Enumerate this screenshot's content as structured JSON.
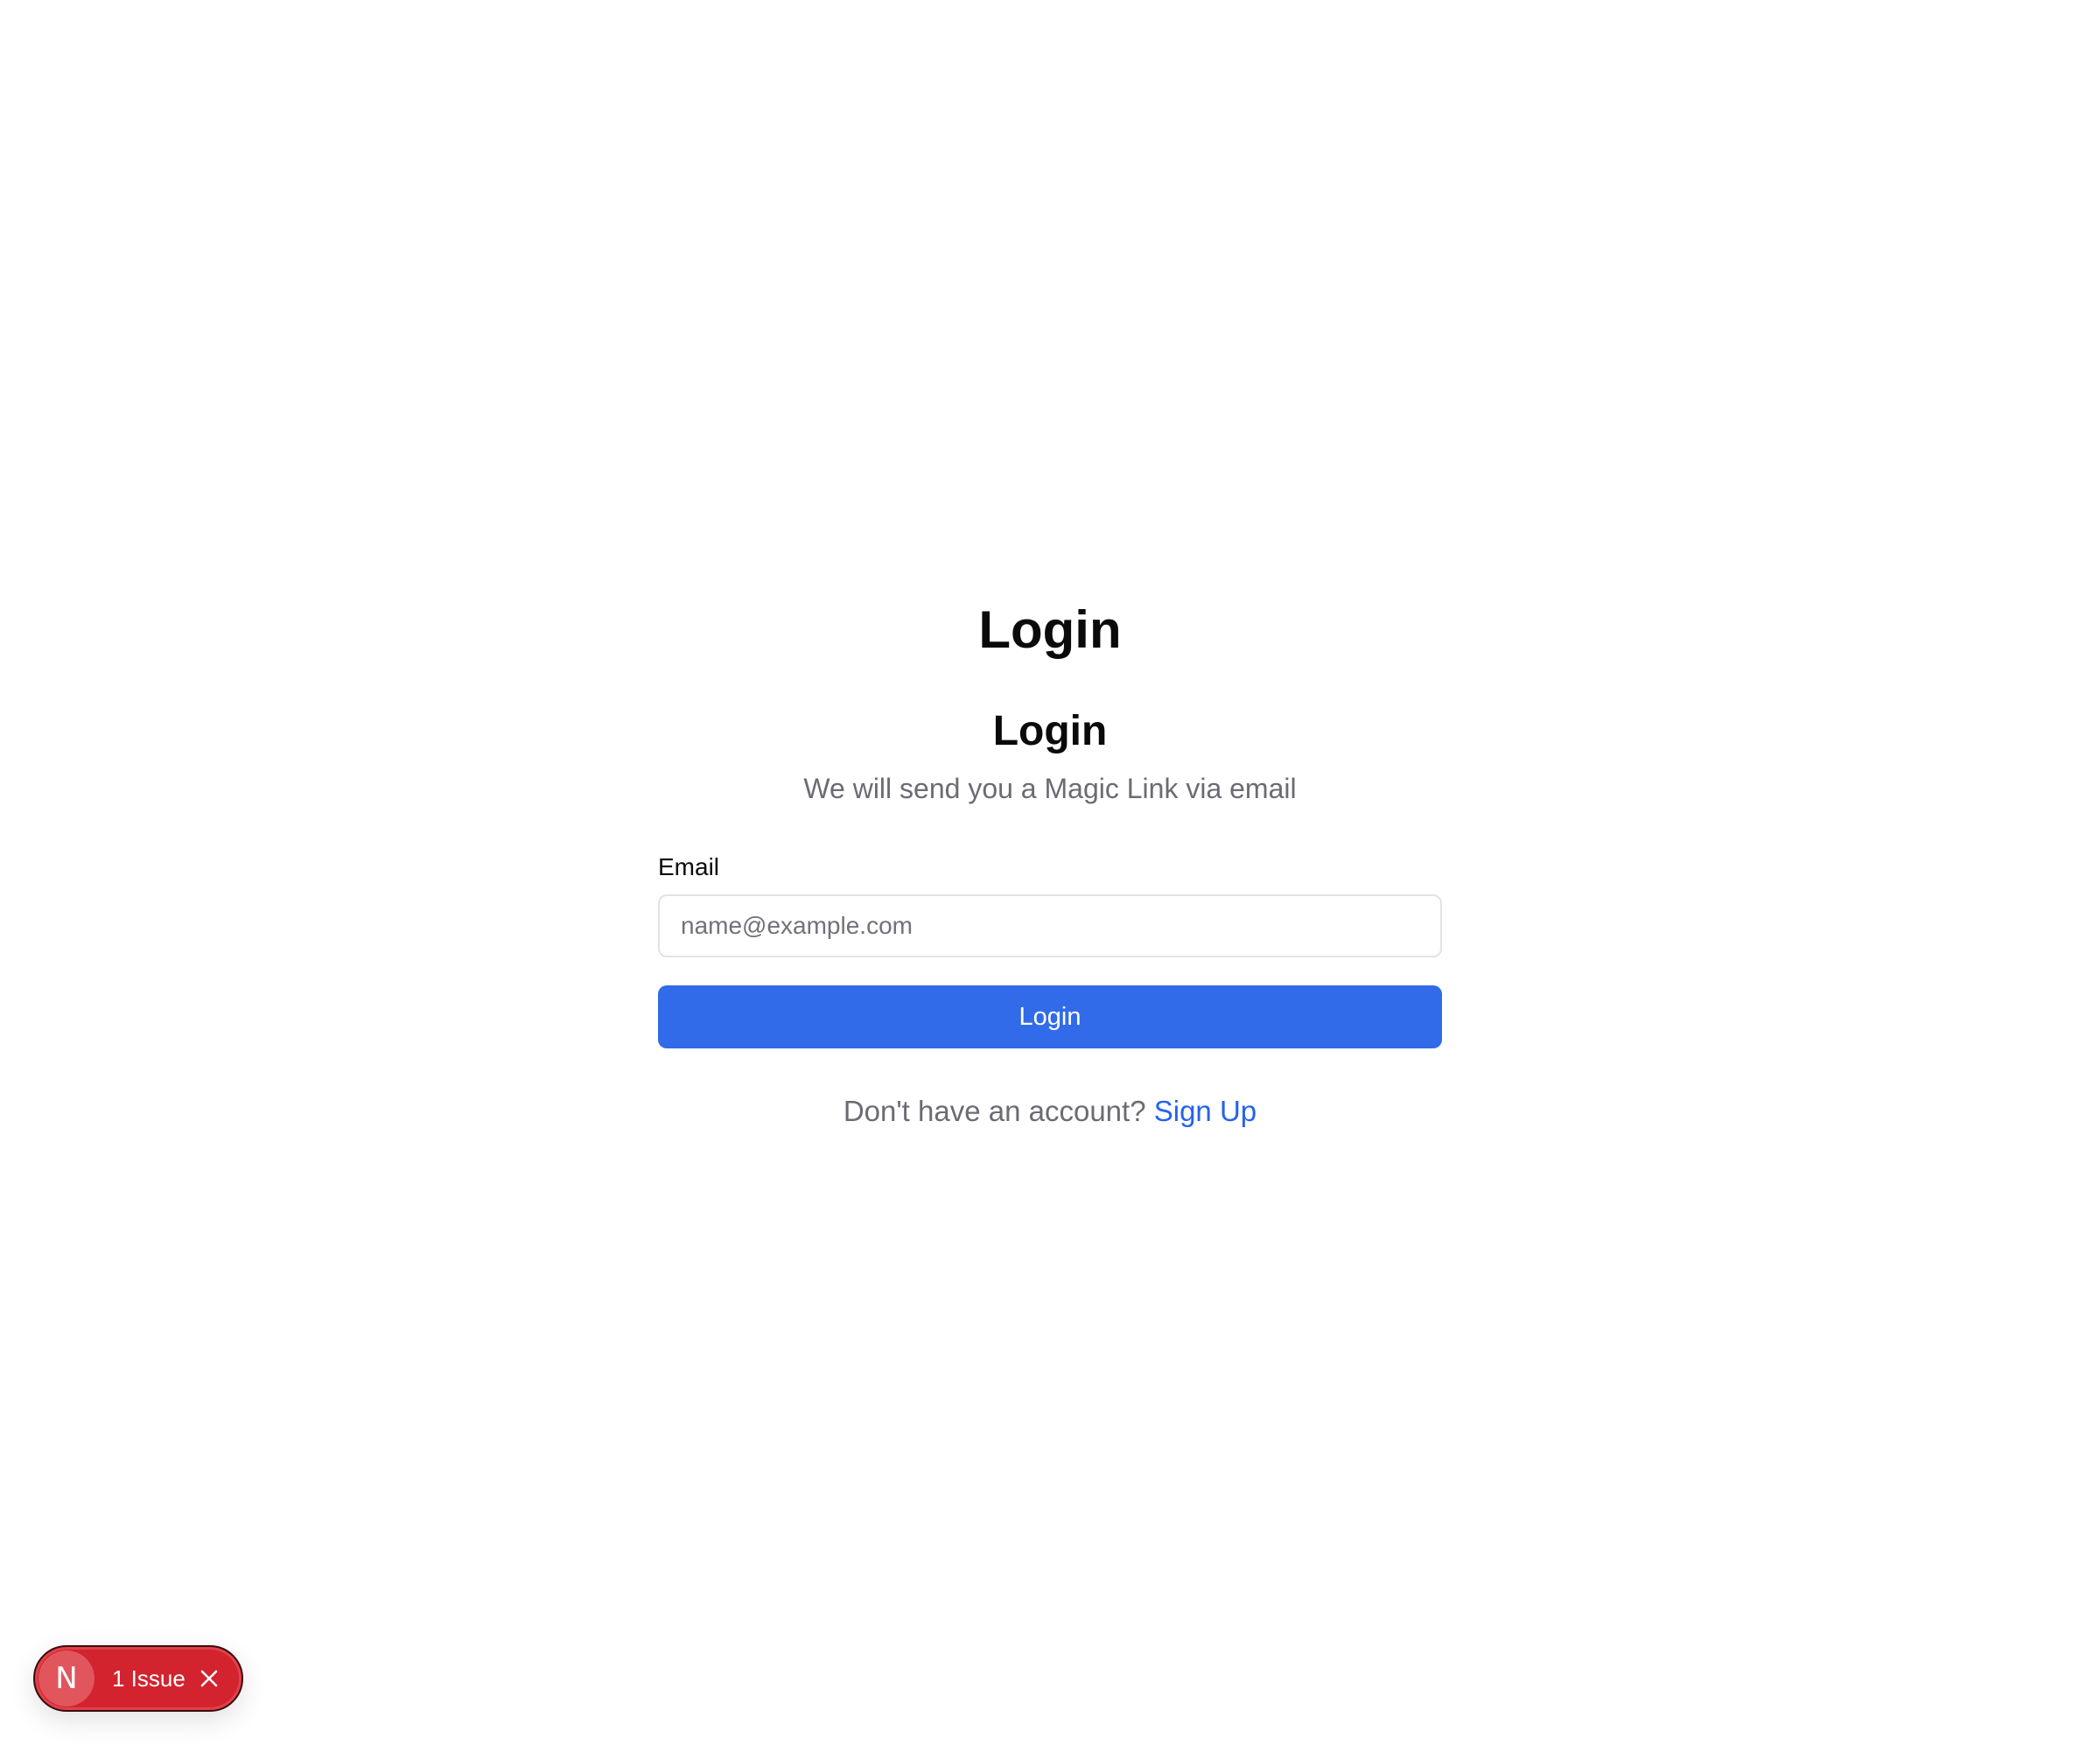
{
  "page": {
    "title": "Login"
  },
  "card": {
    "title": "Login",
    "description": "We will send you a Magic Link via email"
  },
  "form": {
    "email_label": "Email",
    "email_value": "",
    "email_placeholder": "name@example.com",
    "submit_label": "Login"
  },
  "signup": {
    "prompt": "Don't have an account?",
    "link_label": "Sign Up"
  },
  "dev_overlay": {
    "logo_letter": "N",
    "issue_label": "1 Issue",
    "icons": [
      "nextjs-logo-icon",
      "close-icon"
    ],
    "badge_color": "#d2232e"
  },
  "colors": {
    "primary": "#316be9",
    "link": "#2563eb",
    "muted_text": "#6b6b73"
  }
}
